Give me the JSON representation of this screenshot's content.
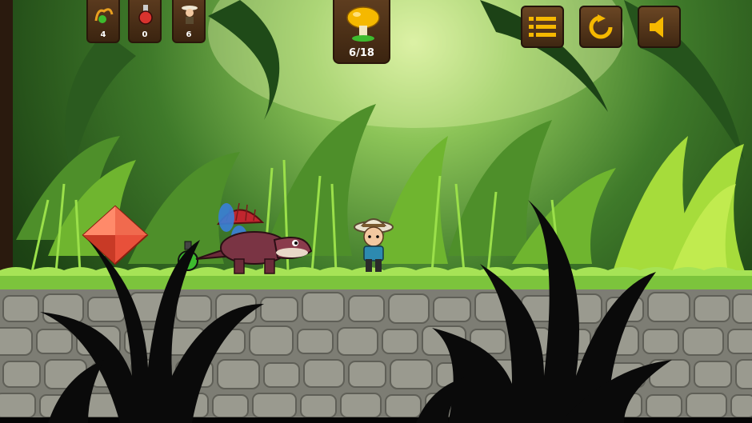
{
  "hud": {
    "inventory": [
      {
        "item": "slingshot-icon",
        "count": "4"
      },
      {
        "item": "potion-icon",
        "count": "0"
      },
      {
        "item": "explorer-icon",
        "count": "6"
      }
    ],
    "mushroom_progress": {
      "icon": "mushroom-icon",
      "text": "6/18"
    },
    "buttons": [
      {
        "name": "menu-button",
        "icon": "list-icon"
      },
      {
        "name": "restart-button",
        "icon": "restart-icon"
      },
      {
        "name": "sound-button",
        "icon": "speaker-icon"
      }
    ]
  },
  "colors": {
    "accent": "#f5b800",
    "panel": "#4a2e16",
    "grass": "#8fd04a",
    "stone": "#8f8f84",
    "gem": "#e8503a"
  }
}
